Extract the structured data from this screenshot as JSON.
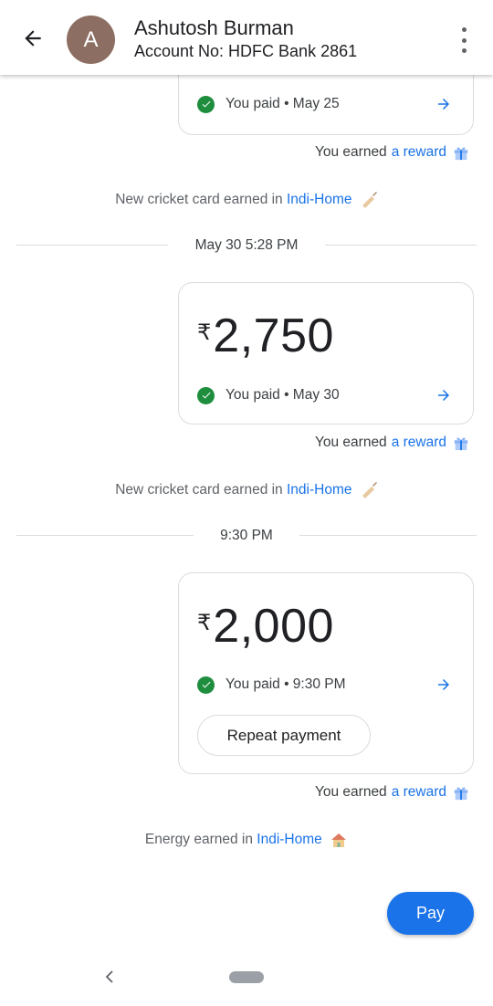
{
  "header": {
    "avatar_letter": "A",
    "contact_name": "Ashutosh Burman",
    "account_line": "Account No: HDFC Bank 2861"
  },
  "transactions": [
    {
      "status": "You paid • May 25",
      "reward_prefix": "You earned",
      "reward_link": "a reward",
      "note_prefix": "New cricket card earned in",
      "note_link": "Indi-Home",
      "note_icon": "cricket-bat-icon"
    },
    {
      "divider": "May 30 5:28 PM",
      "currency": "₹",
      "amount": "2,750",
      "status": "You paid • May 30",
      "reward_prefix": "You earned",
      "reward_link": "a reward",
      "note_prefix": "New cricket card earned in",
      "note_link": "Indi-Home",
      "note_icon": "cricket-bat-icon"
    },
    {
      "divider": "9:30 PM",
      "currency": "₹",
      "amount": "2,000",
      "status": "You paid • 9:30 PM",
      "repeat_label": "Repeat payment",
      "reward_prefix": "You earned",
      "reward_link": "a reward",
      "note_prefix": "Energy earned in",
      "note_link": "Indi-Home",
      "note_icon": "house-icon"
    }
  ],
  "pay_button": "Pay",
  "colors": {
    "accent": "#1a73e8",
    "success": "#1e8e3e",
    "avatar": "#8d6e63"
  }
}
